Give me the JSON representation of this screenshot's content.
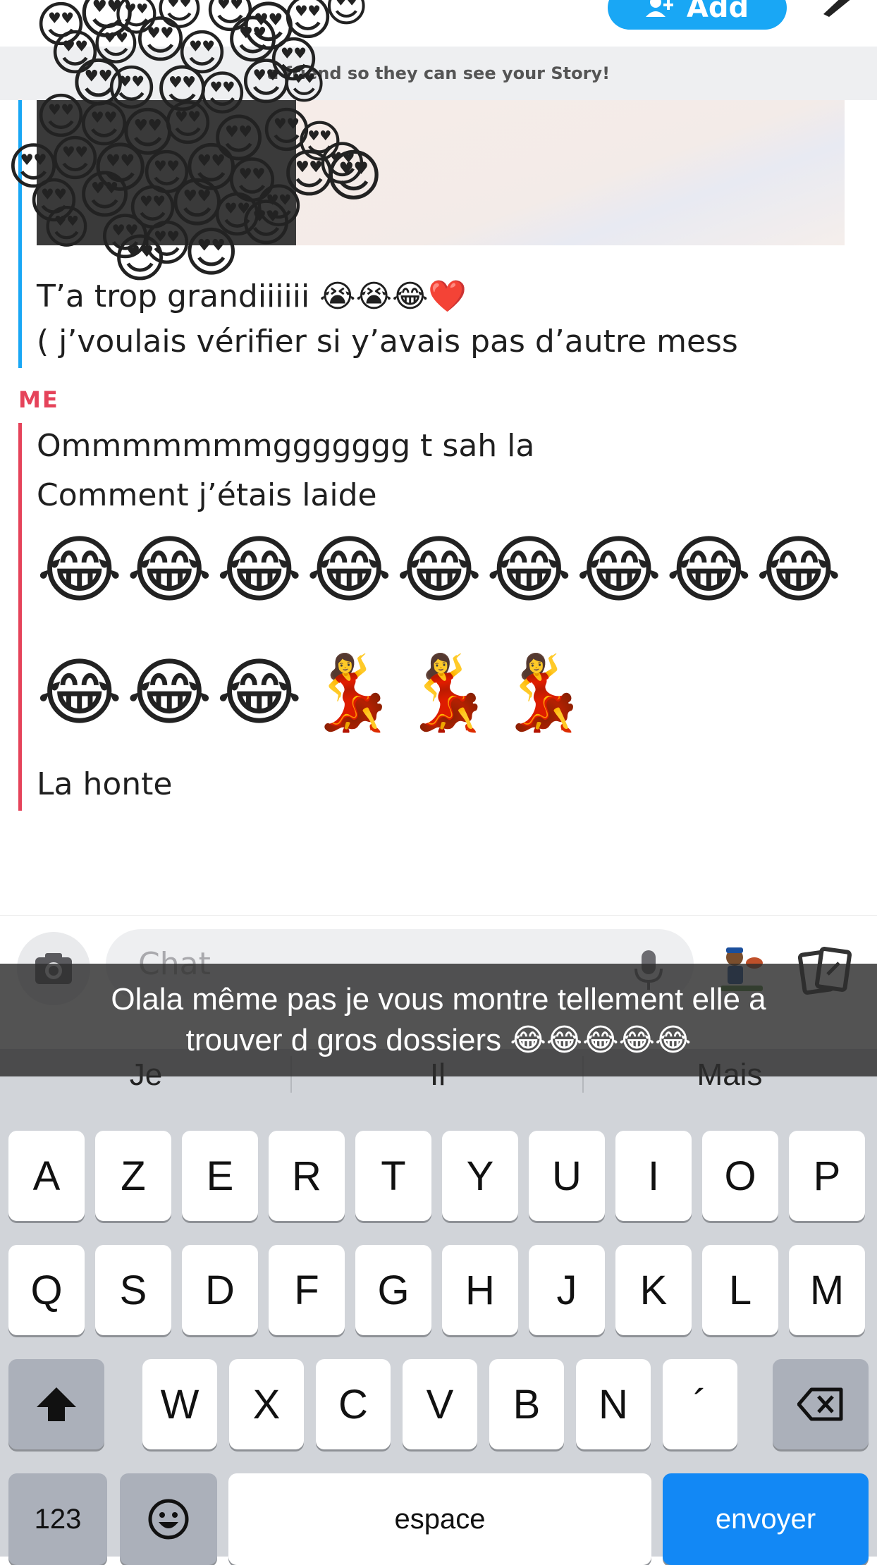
{
  "header": {
    "add_label": "Add",
    "banner_text": "a friend so they can see your Story!"
  },
  "friend_message": {
    "line1": "T’a trop grandiiiiii 😭😭😂❤️",
    "line2": "( j’voulais vérifier si y’avais pas d’autre mess"
  },
  "me": {
    "label": "ME",
    "line1": "Ommmmmmmggggggg t sah la",
    "line2": "Comment j’étais laide",
    "emoji_row1": "😂😂😂😂😂😂😂😂😂",
    "emoji_row2": "😂😂😂💃💃💃",
    "line3": "La honte"
  },
  "chat": {
    "placeholder": "Chat"
  },
  "caption": {
    "line1": "Olala même pas je vous montre tellement elle a",
    "line2": "trouver d gros dossiers 😂😂😂😂😂"
  },
  "keyboard": {
    "suggestions": [
      "Je",
      "Il",
      "Mais"
    ],
    "row1": [
      "A",
      "Z",
      "E",
      "R",
      "T",
      "Y",
      "U",
      "I",
      "O",
      "P"
    ],
    "row2": [
      "Q",
      "S",
      "D",
      "F",
      "G",
      "H",
      "J",
      "K",
      "L",
      "M"
    ],
    "row3": [
      "W",
      "X",
      "C",
      "V",
      "B",
      "N",
      "´"
    ],
    "numbers_label": "123",
    "space_label": "espace",
    "send_label": "envoyer"
  },
  "icons": {
    "camera": "camera-icon",
    "mic": "microphone-icon",
    "bitmoji": "bitmoji-icon",
    "sticker": "sticker-icon",
    "shift": "shift-icon",
    "backspace": "backspace-icon",
    "emoji_key": "emoji-keyboard-icon",
    "pencil": "pencil-icon",
    "add_friend": "add-friend-icon"
  },
  "colors": {
    "accent_blue": "#19a7f5",
    "me_red": "#e5435a",
    "send_blue": "#1288f5"
  }
}
